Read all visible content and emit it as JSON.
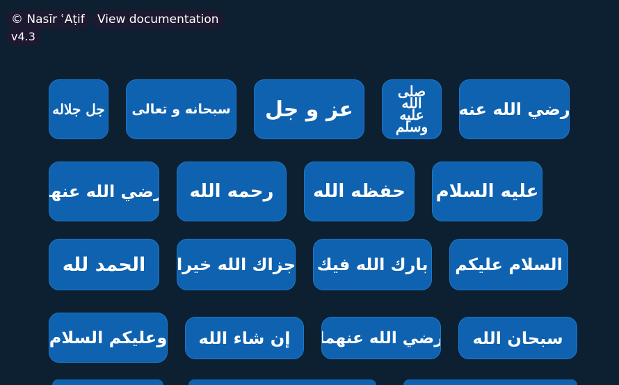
{
  "header": {
    "credit": "© Nasīr ʿAṭif",
    "docs_link": "View documentation",
    "version": "v4.3"
  },
  "buttons": [
    {
      "label": "جل جلاله"
    },
    {
      "label": "سبحانه و تعالى"
    },
    {
      "label": "عز و جل"
    },
    {
      "label": "صلى الله عليه وسلم"
    },
    {
      "label": "رضي الله عنه"
    },
    {
      "label": "رضي الله عنها"
    },
    {
      "label": "رحمه الله"
    },
    {
      "label": "حفظه الله"
    },
    {
      "label": "عليه السلام"
    },
    {
      "label": "الحمد لله"
    },
    {
      "label": "جزاك الله خيرا"
    },
    {
      "label": "بارك الله فيك"
    },
    {
      "label": "السلام عليكم"
    },
    {
      "label": "وعليكم السلام"
    },
    {
      "label": "إن شاء الله"
    },
    {
      "label": "رضي الله عنهما"
    },
    {
      "label": "سبحان الله"
    }
  ],
  "colors": {
    "background": "#0c2031",
    "button": "#0f62b0",
    "pill": "#1d1930"
  }
}
